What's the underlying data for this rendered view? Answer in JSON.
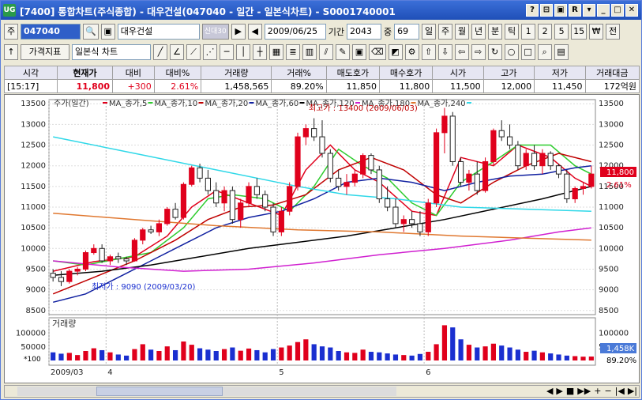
{
  "titlebar": {
    "icon_text": "UG",
    "title": "[7400] 통합차트(주식종합) - 대우건설(047040 - 일간 - 일본식차트) - S0001740001",
    "buttons": [
      "?",
      "⊟",
      "▣",
      "R",
      "▾",
      "_",
      "□",
      "✕"
    ]
  },
  "toolbar1": {
    "market_label": "주",
    "code": "047040",
    "stock_name": "대우건설",
    "credit_label": "신대30",
    "date": "2009/06/25",
    "period_label": "기간",
    "period_value": "2043",
    "count_label": "중",
    "count_value": "69",
    "timeframes": [
      "일",
      "주",
      "월",
      "년",
      "분",
      "틱",
      "1",
      "2",
      "5",
      "15",
      "₩",
      "전"
    ]
  },
  "toolbar2": {
    "indicator_label": "가격지표",
    "chart_type": "일본식 차트"
  },
  "info": {
    "headers": [
      "시각",
      "현재가",
      "대비",
      "대비%",
      "거래량",
      "거래%",
      "매도호가",
      "매수호가",
      "시가",
      "고가",
      "저가",
      "거래대금"
    ],
    "values": [
      "[15:17]",
      "11,800",
      "+300",
      "2.61%",
      "1,458,565",
      "89.20%",
      "11,850",
      "11,800",
      "11,500",
      "12,000",
      "11,450",
      "172억원"
    ]
  },
  "legend": {
    "price": "주가(일간)",
    "ma": [
      {
        "name": "MA_종가,5",
        "color": "#e0001c"
      },
      {
        "name": "MA_종가,10",
        "color": "#2ecc2e"
      },
      {
        "name": "MA_종가,20",
        "color": "#c00000"
      },
      {
        "name": "MA_종가,60",
        "color": "#1020a0"
      },
      {
        "name": "MA_종가,120",
        "color": "#000000"
      },
      {
        "name": "MA_종가,180",
        "color": "#d020d0"
      },
      {
        "name": "MA_종가,240",
        "color": "#e07830"
      },
      {
        "name": "",
        "color": "#30d8e8"
      }
    ],
    "volume": "거래량"
  },
  "annotations": {
    "high": "최고가 : 13400 (2009/06/03)",
    "low": "최저가 : 9090 (2009/03/20)"
  },
  "price_badge": {
    "value": "11,800",
    "pct": "2.61%"
  },
  "volume_badge": {
    "value": "1,458K",
    "pct": "89.20%"
  },
  "volume_unit": "*100",
  "colors": {
    "up": "#e0001c",
    "down": "#1a2fd0",
    "badge_bg": "#e0001c",
    "badge_vol": "#4a7ad8"
  },
  "chart_data": {
    "type": "candlestick",
    "y_ticks": [
      8500,
      9000,
      9500,
      10000,
      10500,
      11000,
      11500,
      12000,
      12500,
      13000,
      13500
    ],
    "ylim": [
      8400,
      13600
    ],
    "vol_ticks": [
      50000,
      100000
    ],
    "vol_tick_labels": [
      "50000",
      "100000"
    ],
    "vol_lim": [
      0,
      140000
    ],
    "x_labels": [
      {
        "i": 0,
        "label": "2009/03"
      },
      {
        "i": 7,
        "label": "4"
      },
      {
        "i": 28,
        "label": "5"
      },
      {
        "i": 46,
        "label": "6"
      }
    ],
    "candles": [
      [
        9400,
        9500,
        9200,
        9300
      ],
      [
        9300,
        9450,
        9090,
        9200
      ],
      [
        9200,
        9500,
        9150,
        9450
      ],
      [
        9450,
        9550,
        9350,
        9500
      ],
      [
        9500,
        9950,
        9450,
        9900
      ],
      [
        9900,
        10100,
        9850,
        10000
      ],
      [
        10000,
        10100,
        9650,
        9700
      ],
      [
        9700,
        9850,
        9600,
        9800
      ],
      [
        9800,
        9900,
        9650,
        9750
      ],
      [
        9750,
        9800,
        9600,
        9700
      ],
      [
        9700,
        10250,
        9680,
        10200
      ],
      [
        10200,
        10500,
        10100,
        10450
      ],
      [
        10450,
        10550,
        10350,
        10400
      ],
      [
        10400,
        10700,
        10300,
        10600
      ],
      [
        10600,
        11000,
        10550,
        10950
      ],
      [
        10950,
        11100,
        10700,
        10750
      ],
      [
        10750,
        11600,
        10700,
        11550
      ],
      [
        11550,
        12000,
        11500,
        11950
      ],
      [
        11950,
        12050,
        11600,
        11700
      ],
      [
        11700,
        11900,
        11300,
        11400
      ],
      [
        11400,
        11600,
        11000,
        11100
      ],
      [
        11100,
        11500,
        10900,
        11400
      ],
      [
        11400,
        11500,
        10600,
        10700
      ],
      [
        10700,
        11200,
        10500,
        11100
      ],
      [
        11100,
        11600,
        11000,
        11500
      ],
      [
        11500,
        11700,
        11200,
        11300
      ],
      [
        11300,
        11400,
        10900,
        11000
      ],
      [
        11000,
        11100,
        10300,
        10400
      ],
      [
        10400,
        11000,
        10300,
        10900
      ],
      [
        10900,
        11600,
        10800,
        11500
      ],
      [
        11500,
        12800,
        11400,
        12700
      ],
      [
        12700,
        13000,
        12500,
        12900
      ],
      [
        12900,
        13150,
        12600,
        12700
      ],
      [
        12700,
        13100,
        12200,
        12300
      ],
      [
        12300,
        12400,
        11600,
        11700
      ],
      [
        11700,
        11900,
        11400,
        11500
      ],
      [
        11500,
        11800,
        11300,
        11600
      ],
      [
        11600,
        11900,
        11500,
        11800
      ],
      [
        11800,
        12300,
        11700,
        12250
      ],
      [
        12250,
        12300,
        11800,
        11900
      ],
      [
        11900,
        12000,
        11100,
        11200
      ],
      [
        11200,
        11500,
        10900,
        11000
      ],
      [
        11000,
        11200,
        10500,
        10600
      ],
      [
        10600,
        10800,
        10400,
        10700
      ],
      [
        10700,
        10900,
        10500,
        10600
      ],
      [
        10600,
        10900,
        10300,
        10400
      ],
      [
        10400,
        11200,
        10300,
        11100
      ],
      [
        11100,
        12900,
        11000,
        12800
      ],
      [
        12800,
        13400,
        12300,
        13200
      ],
      [
        13200,
        13300,
        12000,
        12100
      ],
      [
        12100,
        12200,
        11500,
        11600
      ],
      [
        11600,
        11900,
        11400,
        11800
      ],
      [
        11800,
        12100,
        11300,
        11400
      ],
      [
        11400,
        12200,
        11350,
        12100
      ],
      [
        12100,
        12900,
        12000,
        12850
      ],
      [
        12850,
        13100,
        12600,
        12700
      ],
      [
        12700,
        13000,
        12400,
        12500
      ],
      [
        12500,
        12600,
        11900,
        12000
      ],
      [
        12000,
        12400,
        11900,
        12300
      ],
      [
        12300,
        12500,
        11900,
        12000
      ],
      [
        12000,
        12400,
        11800,
        12300
      ],
      [
        12300,
        12350,
        11900,
        12000
      ],
      [
        12000,
        12050,
        11700,
        11800
      ],
      [
        11800,
        11900,
        11100,
        11200
      ],
      [
        11200,
        11500,
        11100,
        11450
      ],
      [
        11450,
        11600,
        11300,
        11500
      ],
      [
        11500,
        12000,
        11450,
        11800
      ]
    ],
    "volumes": [
      30000,
      25000,
      28000,
      20000,
      35000,
      45000,
      38000,
      30000,
      22000,
      18000,
      42000,
      60000,
      40000,
      35000,
      52000,
      38000,
      70000,
      58000,
      45000,
      40000,
      35000,
      42000,
      48000,
      36000,
      44000,
      38000,
      30000,
      42000,
      48000,
      55000,
      68000,
      78000,
      60000,
      52000,
      48000,
      35000,
      30000,
      28000,
      40000,
      32000,
      30000,
      26000,
      22000,
      20000,
      18000,
      24000,
      32000,
      60000,
      130000,
      122000,
      78000,
      58000,
      48000,
      52000,
      62000,
      55000,
      48000,
      40000,
      32000,
      36000,
      30000,
      26000,
      22000,
      18000,
      16000,
      14000,
      14500
    ],
    "ma_lines": [
      {
        "name": "MA_종가,5",
        "color": "#e0001c",
        "pts": [
          [
            0,
            9450
          ],
          [
            5,
            9680
          ],
          [
            10,
            9800
          ],
          [
            14,
            10300
          ],
          [
            17,
            11000
          ],
          [
            20,
            11400
          ],
          [
            24,
            11100
          ],
          [
            28,
            10800
          ],
          [
            31,
            11900
          ],
          [
            34,
            12500
          ],
          [
            37,
            11900
          ],
          [
            40,
            11600
          ],
          [
            44,
            10900
          ],
          [
            47,
            10800
          ],
          [
            50,
            12200
          ],
          [
            54,
            12000
          ],
          [
            57,
            12500
          ],
          [
            61,
            12200
          ],
          [
            64,
            11700
          ],
          [
            66,
            11500
          ]
        ]
      },
      {
        "name": "MA_종가,10",
        "color": "#2ecc2e",
        "pts": [
          [
            0,
            9700
          ],
          [
            4,
            9600
          ],
          [
            8,
            9750
          ],
          [
            12,
            9900
          ],
          [
            16,
            10500
          ],
          [
            19,
            11200
          ],
          [
            22,
            11300
          ],
          [
            26,
            11200
          ],
          [
            29,
            10900
          ],
          [
            32,
            11500
          ],
          [
            35,
            12400
          ],
          [
            38,
            12000
          ],
          [
            41,
            11700
          ],
          [
            44,
            11100
          ],
          [
            47,
            10800
          ],
          [
            50,
            11600
          ],
          [
            54,
            12100
          ],
          [
            57,
            12500
          ],
          [
            61,
            12500
          ],
          [
            64,
            12000
          ],
          [
            66,
            11800
          ]
        ]
      },
      {
        "name": "MA_종가,20",
        "color": "#c00000",
        "pts": [
          [
            0,
            8900
          ],
          [
            5,
            9300
          ],
          [
            10,
            9700
          ],
          [
            15,
            10200
          ],
          [
            19,
            10700
          ],
          [
            23,
            11000
          ],
          [
            27,
            11050
          ],
          [
            31,
            11300
          ],
          [
            35,
            11900
          ],
          [
            39,
            12200
          ],
          [
            43,
            11900
          ],
          [
            47,
            11300
          ],
          [
            50,
            11100
          ],
          [
            54,
            11600
          ],
          [
            58,
            12000
          ],
          [
            62,
            12300
          ],
          [
            66,
            12100
          ]
        ]
      },
      {
        "name": "MA_종가,60",
        "color": "#1020a0",
        "pts": [
          [
            0,
            8700
          ],
          [
            4,
            8900
          ],
          [
            8,
            9300
          ],
          [
            12,
            9700
          ],
          [
            16,
            10100
          ],
          [
            20,
            10500
          ],
          [
            24,
            10750
          ],
          [
            28,
            10900
          ],
          [
            32,
            11200
          ],
          [
            36,
            11600
          ],
          [
            40,
            11700
          ],
          [
            44,
            11600
          ],
          [
            48,
            11400
          ],
          [
            52,
            11600
          ],
          [
            56,
            11750
          ],
          [
            60,
            11800
          ],
          [
            64,
            11950
          ],
          [
            66,
            12000
          ]
        ]
      },
      {
        "name": "MA_종가,120",
        "color": "#000000",
        "pts": [
          [
            0,
            9350
          ],
          [
            6,
            9450
          ],
          [
            12,
            9600
          ],
          [
            18,
            9800
          ],
          [
            24,
            10000
          ],
          [
            30,
            10150
          ],
          [
            36,
            10300
          ],
          [
            42,
            10500
          ],
          [
            48,
            10700
          ],
          [
            54,
            10950
          ],
          [
            60,
            11200
          ],
          [
            66,
            11500
          ]
        ]
      },
      {
        "name": "MA_종가,180",
        "color": "#d020d0",
        "pts": [
          [
            0,
            9700
          ],
          [
            8,
            9550
          ],
          [
            16,
            9450
          ],
          [
            24,
            9500
          ],
          [
            32,
            9650
          ],
          [
            40,
            9850
          ],
          [
            48,
            10000
          ],
          [
            56,
            10200
          ],
          [
            62,
            10400
          ],
          [
            66,
            10500
          ]
        ]
      },
      {
        "name": "MA_종가,240",
        "color": "#e07830",
        "pts": [
          [
            0,
            10850
          ],
          [
            10,
            10700
          ],
          [
            20,
            10550
          ],
          [
            30,
            10450
          ],
          [
            40,
            10400
          ],
          [
            50,
            10300
          ],
          [
            58,
            10250
          ],
          [
            66,
            10200
          ]
        ]
      },
      {
        "name": "",
        "color": "#30d8e8",
        "pts": [
          [
            0,
            12700
          ],
          [
            10,
            12300
          ],
          [
            20,
            11900
          ],
          [
            30,
            11500
          ],
          [
            36,
            11300
          ],
          [
            42,
            11200
          ],
          [
            50,
            11000
          ],
          [
            58,
            10950
          ],
          [
            66,
            10900
          ]
        ]
      }
    ]
  }
}
